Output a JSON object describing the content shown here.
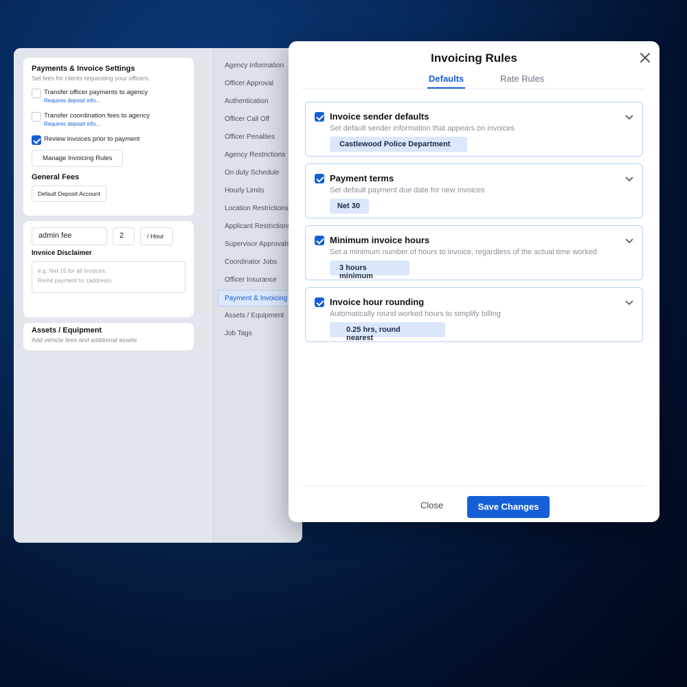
{
  "settings": {
    "payments_card": {
      "title": "Payments & Invoice Settings",
      "subtitle": "Set fees for clients requesting your officers.",
      "options": [
        {
          "label": "Transfer officer payments to agency",
          "note": "Requires deposit info...",
          "checked": false
        },
        {
          "label": "Transfer coordination fees to agency",
          "note": "Requires deposit info...",
          "checked": false
        },
        {
          "label": "Review invoices prior to payment",
          "note": "",
          "checked": true
        }
      ],
      "manage_button": "Manage Invoicing Rules",
      "general_fees_title": "General Fees",
      "deposit_button": "Default Deposit Account"
    },
    "fees_card": {
      "fee_name": "admin fee",
      "fee_amount": "2",
      "fee_unit": "/ Hour",
      "disclaimer_title": "Invoice Disclaimer",
      "disclaimer_placeholder": "e.g. Net 15 for all invoices.\nRemit payment to: (address)"
    },
    "assets_card": {
      "title": "Assets / Equipment",
      "subtitle": "Add vehicle fees and additional assets"
    }
  },
  "nav": {
    "items": [
      "Agency Information",
      "Officer Approval",
      "Authentication",
      "Officer Call Off",
      "Officer Penalties",
      "Agency Restrictions",
      "On duty Schedule",
      "Hourly Limits",
      "Location Restrictions",
      "Applicant Restrictions",
      "Supervisor Approvals",
      "Coordinator Jobs",
      "Officer Insurance",
      "Payment & Invoicing",
      "Assets / Equipment",
      "Job Tags"
    ],
    "active": "Payment & Invoicing"
  },
  "modal": {
    "title": "Invoicing Rules",
    "tabs": [
      "Defaults",
      "Rate Rules"
    ],
    "active_tab": "Defaults",
    "rules": [
      {
        "title": "Invoice sender defaults",
        "description": "Set default sender information that appears on invoices",
        "value": "Castlewood Police Department",
        "checked": true
      },
      {
        "title": "Payment terms",
        "description": "Set default payment due date for new invoices",
        "value": "Net 30",
        "checked": true
      },
      {
        "title": "Minimum invoice hours",
        "description": "Set a minimum number of hours to invoice, regardless of the actual time worked",
        "value": "3 hours minimum",
        "checked": true
      },
      {
        "title": "Invoice hour rounding",
        "description": "Automatically round worked hours to simplify billing",
        "value": "0.25 hrs, round nearest",
        "checked": true
      }
    ],
    "close_label": "Close",
    "save_label": "Save Changes"
  },
  "colors": {
    "accent": "#1560d6",
    "pill_bg": "#dbe7fb"
  }
}
